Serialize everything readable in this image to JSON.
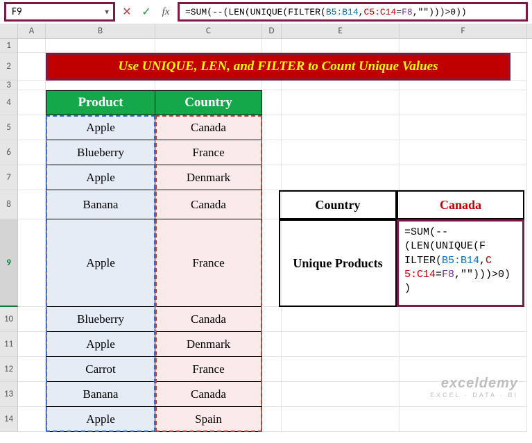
{
  "namebox": {
    "value": "F9"
  },
  "formula_bar": {
    "prefix": "=SUM(--(LEN(UNIQUE(FILTER(",
    "range1": "B5:B14",
    "sep1": ",",
    "range2": "C5:C14",
    "eq": "=",
    "range3": "F8",
    "suffix": ",\"\")))>0))"
  },
  "columns": {
    "A": "A",
    "B": "B",
    "C": "C",
    "D": "D",
    "E": "E",
    "F": "F"
  },
  "row_labels": [
    "1",
    "2",
    "3",
    "4",
    "5",
    "6",
    "7",
    "8",
    "9",
    "10",
    "11",
    "12",
    "13",
    "14"
  ],
  "banner": "Use UNIQUE, LEN, and FILTER to Count Unique Values",
  "headers": {
    "product": "Product",
    "country": "Country"
  },
  "data": [
    {
      "product": "Apple",
      "country": "Canada"
    },
    {
      "product": "Blueberry",
      "country": "France"
    },
    {
      "product": "Apple",
      "country": "Denmark"
    },
    {
      "product": "Banana",
      "country": "Canada"
    },
    {
      "product": "Apple",
      "country": "France"
    },
    {
      "product": "Blueberry",
      "country": "Canada"
    },
    {
      "product": "Apple",
      "country": "Denmark"
    },
    {
      "product": "Carrot",
      "country": "France"
    },
    {
      "product": "Banana",
      "country": "Canada"
    },
    {
      "product": "Apple",
      "country": "Spain"
    }
  ],
  "side": {
    "country_label": "Country",
    "country_value": "Canada",
    "unique_label": "Unique Products",
    "formula_parts": {
      "p1": "=SUM(--",
      "p2": "(LEN(UNIQUE(F",
      "p3_a": "ILTER(",
      "p3_b": "B5:B14",
      "p3_c": ",",
      "p3_d": "C",
      "p4_a": "5:C14",
      "p4_b": "=",
      "p4_c": "F8",
      "p4_d": ",\"\")))>0)",
      "p5": ")"
    }
  },
  "watermark": {
    "line1": "exceldemy",
    "line2": "EXCEL · DATA · BI"
  },
  "chart_data": {
    "type": "table",
    "title": "Use UNIQUE, LEN, and FILTER to Count Unique Values",
    "columns": [
      "Product",
      "Country"
    ],
    "rows": [
      [
        "Apple",
        "Canada"
      ],
      [
        "Blueberry",
        "France"
      ],
      [
        "Apple",
        "Denmark"
      ],
      [
        "Banana",
        "Canada"
      ],
      [
        "Apple",
        "France"
      ],
      [
        "Blueberry",
        "Canada"
      ],
      [
        "Apple",
        "Denmark"
      ],
      [
        "Carrot",
        "France"
      ],
      [
        "Banana",
        "Canada"
      ],
      [
        "Apple",
        "Spain"
      ]
    ],
    "lookup": {
      "Country": "Canada",
      "Unique Products formula": "=SUM(--(LEN(UNIQUE(FILTER(B5:B14,C5:C14=F8,\"\")))>0))"
    }
  }
}
